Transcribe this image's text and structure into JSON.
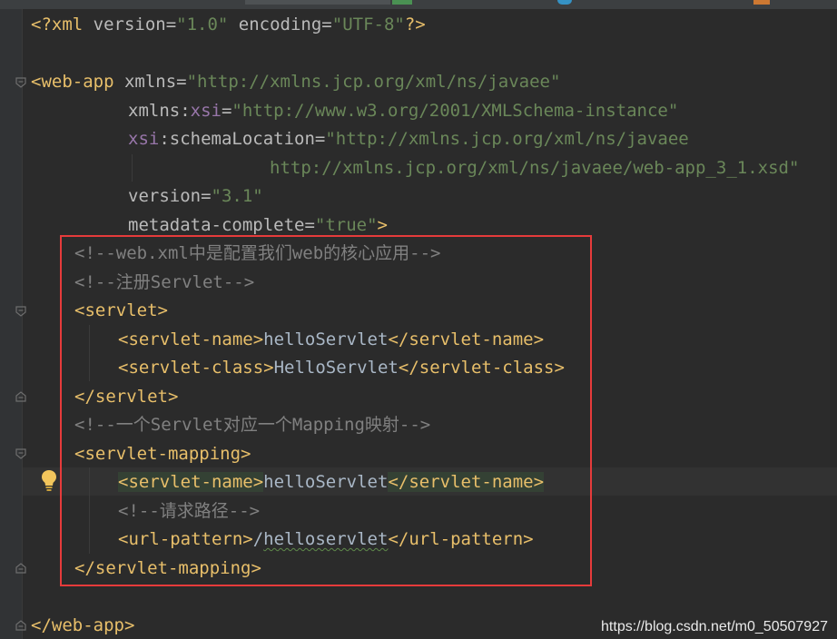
{
  "colors": {
    "background": "#2b2b2b",
    "gutter": "#313335",
    "tag": "#e8bf6a",
    "attribute": "#bababa",
    "namespace": "#9876aa",
    "value": "#6a8759",
    "comment": "#808080",
    "text": "#a9b7c6",
    "highlight_box": "#e63b3b"
  },
  "editor": {
    "lines": {
      "xml_decl": {
        "open": "<?xml",
        "version_attr": " version=",
        "version_val": "\"1.0\"",
        "encoding_attr": " encoding=",
        "encoding_val": "\"UTF-8\"",
        "close": "?>"
      },
      "webapp_open": {
        "tag": "<web-app",
        "xmlns_attr": " xmlns=",
        "xmlns_val": "\"http://xmlns.jcp.org/xml/ns/javaee\""
      },
      "xmlns_xsi": {
        "prefix": "xmlns:",
        "name": "xsi",
        "eq": "=",
        "val": "\"http://www.w3.org/2001/XMLSchema-instance\""
      },
      "schema_location": {
        "ns": "xsi",
        "name": ":schemaLocation=",
        "val": "\"http://xmlns.jcp.org/xml/ns/javaee"
      },
      "schema_location_cont": {
        "val": "http://xmlns.jcp.org/xml/ns/javaee/web-app_3_1.xsd\""
      },
      "version": {
        "attr": "version=",
        "val": "\"3.1\""
      },
      "metadata": {
        "attr": "metadata-complete=",
        "val": "\"true\"",
        "close": ">"
      },
      "comment_core": "<!--web.xml中是配置我们web的核心应用-->",
      "comment_register": "<!--注册Servlet-->",
      "servlet_open": "<servlet>",
      "servlet_name": {
        "open": "<servlet-name>",
        "text": "helloServlet",
        "close": "</servlet-name>"
      },
      "servlet_class": {
        "open": "<servlet-class>",
        "text": "HelloServlet",
        "close": "</servlet-class>"
      },
      "servlet_close": "</servlet>",
      "comment_mapping": "<!--一个Servlet对应一个Mapping映射-->",
      "mapping_open": "<servlet-mapping>",
      "mapping_name": {
        "open": "<servlet-name>",
        "text": "helloServlet",
        "close": "</servlet-name>"
      },
      "comment_path": "<!--请求路径-->",
      "url_pattern": {
        "open": "<url-pattern>",
        "slash": "/",
        "text": "helloservlet",
        "close": "</url-pattern>"
      },
      "mapping_close": "</servlet-mapping>",
      "webapp_close": "</web-app>"
    }
  },
  "watermark": "https://blog.csdn.net/m0_50507927",
  "icons": {
    "fold": "fold-marker-icon",
    "bulb": "lightbulb-icon"
  }
}
